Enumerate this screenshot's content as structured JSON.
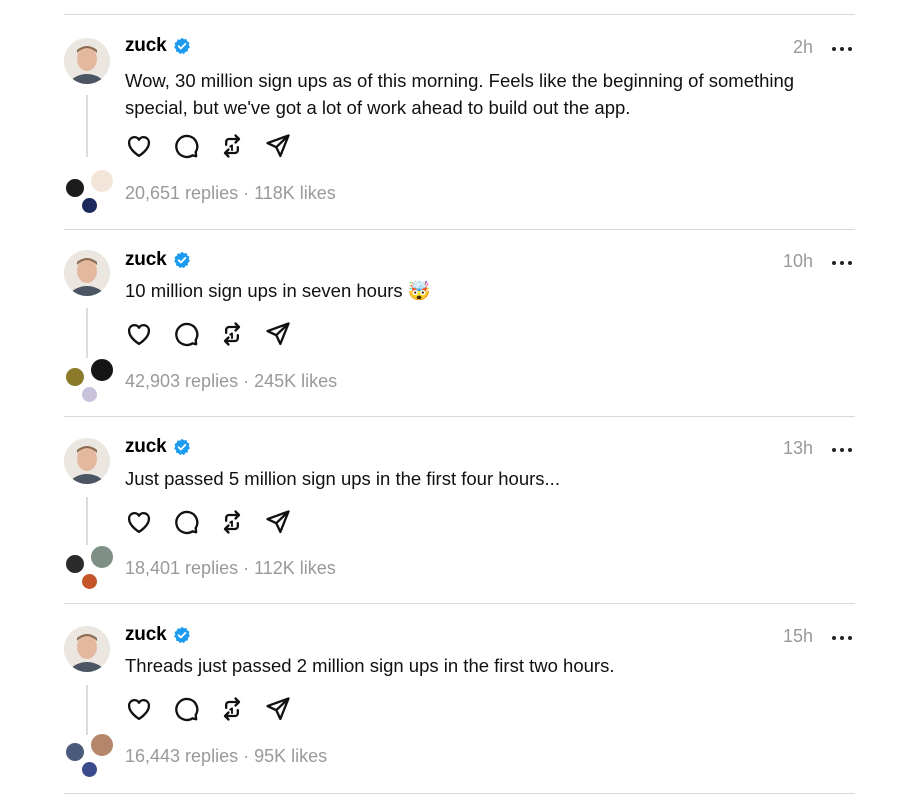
{
  "posts": [
    {
      "username": "zuck",
      "time": "2h",
      "text": "Wow, 30 million sign ups as of this morning. Feels like the beginning of something special, but we've got a lot of work ahead to build out the app.",
      "stats": "20,651 replies · 118K likes"
    },
    {
      "username": "zuck",
      "time": "10h",
      "text": "10 million sign ups in seven hours 🤯",
      "stats": "42,903 replies · 245K likes"
    },
    {
      "username": "zuck",
      "time": "13h",
      "text": "Just passed 5 million sign ups in the first four hours...",
      "stats": "18,401 replies · 112K likes"
    },
    {
      "username": "zuck",
      "time": "15h",
      "text": "Threads just passed 2 million sign ups in the first two hours.",
      "stats": "16,443 replies · 95K likes"
    }
  ],
  "icons": {
    "verified": "verified-badge-icon",
    "like": "heart-icon",
    "reply": "comment-bubble-icon",
    "repost": "repost-icon",
    "share": "send-icon",
    "more": "more-dots-icon"
  },
  "colors": {
    "verified": "#1d9bf0",
    "meta_text": "#999999",
    "divider": "#d9d9d9"
  }
}
